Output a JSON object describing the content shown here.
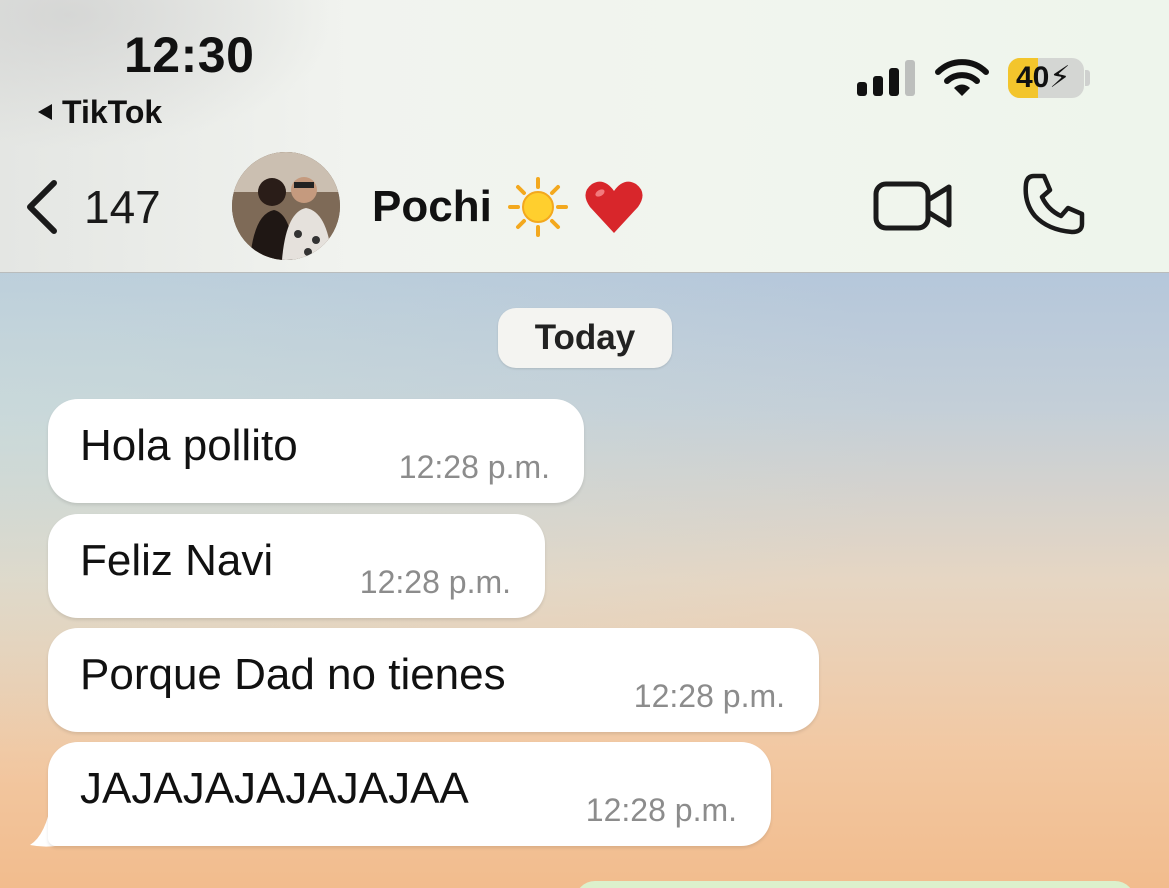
{
  "status_bar": {
    "time": "12:30",
    "back_app": "TikTok",
    "battery": "40",
    "battery_level": 0.4,
    "battery_color": "#f3c52c"
  },
  "header": {
    "unread_count": "147",
    "contact_name": "Pochi",
    "name_emojis": "☀️❤️"
  },
  "chat": {
    "date_label": "Today",
    "messages": [
      {
        "text": "Hola pollito",
        "time": "12:28 p.m."
      },
      {
        "text": "Feliz Navi",
        "time": "12:28 p.m."
      },
      {
        "text": "Porque Dad no tienes",
        "time": "12:28 p.m."
      },
      {
        "text": "JAJAJAJAJAJAJAA",
        "time": "12:28 p.m."
      }
    ]
  },
  "colors": {
    "bubble_incoming": "#ffffff",
    "bubble_outgoing": "#dcf0cc",
    "timestamp": "#8c8c8c"
  }
}
